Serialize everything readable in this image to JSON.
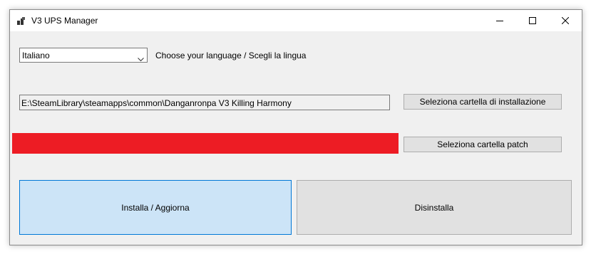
{
  "window": {
    "title": "V3 UPS Manager",
    "icon": "app-icon",
    "controls": [
      "minimize-icon",
      "maximize-icon",
      "close-icon"
    ]
  },
  "language": {
    "selected": "Italiano",
    "label": "Choose your language / Scegli la lingua"
  },
  "install_path": {
    "value": "E:\\SteamLibrary\\steamapps\\common\\Danganronpa V3 Killing Harmony",
    "button_label": "Seleziona cartella di installazione"
  },
  "patch": {
    "button_label": "Seleziona cartella patch",
    "progress_color": "#ed1c24"
  },
  "actions": {
    "install_label": "Installa / Aggiorna",
    "uninstall_label": "Disinstalla"
  },
  "colors": {
    "accent": "#0078d7",
    "install_bg": "#cce4f7",
    "window_bg": "#f0f0f0"
  }
}
